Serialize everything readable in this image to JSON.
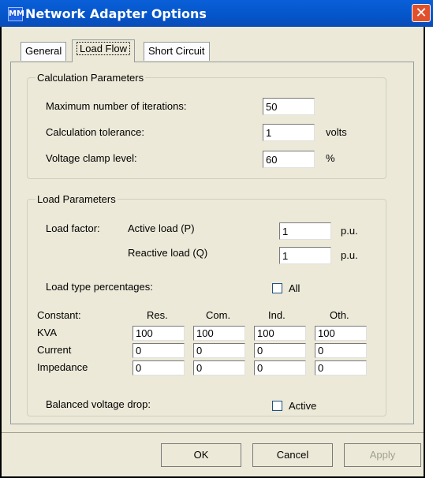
{
  "window": {
    "title": "Network Adapter Options",
    "icon": "MM",
    "close_glyph": "✕"
  },
  "tabs": [
    {
      "label": "General"
    },
    {
      "label": "Load Flow"
    },
    {
      "label": "Short Circuit"
    }
  ],
  "calculation": {
    "legend": "Calculation Parameters",
    "max_iterations": {
      "label": "Maximum number of iterations:",
      "value": "50"
    },
    "tolerance": {
      "label": "Calculation tolerance:",
      "value": "1",
      "unit": "volts"
    },
    "clamp": {
      "label": "Voltage clamp level:",
      "value": "60",
      "unit": "%"
    }
  },
  "load": {
    "legend": "Load Parameters",
    "load_factor_label": "Load factor:",
    "active": {
      "label": "Active load (P)",
      "value": "1",
      "unit": "p.u."
    },
    "reactive": {
      "label": "Reactive load (Q)",
      "value": "1",
      "unit": "p.u."
    },
    "type_percentages_label": "Load type percentages:",
    "all_label": "All",
    "constant_label": "Constant:",
    "columns": [
      "Res.",
      "Com.",
      "Ind.",
      "Oth."
    ],
    "rows": [
      {
        "label": "KVA",
        "values": [
          "100",
          "100",
          "100",
          "100"
        ]
      },
      {
        "label": "Current",
        "values": [
          "0",
          "0",
          "0",
          "0"
        ]
      },
      {
        "label": "Impedance",
        "values": [
          "0",
          "0",
          "0",
          "0"
        ]
      }
    ],
    "balanced_label": "Balanced voltage drop:",
    "active_label": "Active"
  },
  "buttons": {
    "ok": "OK",
    "cancel": "Cancel",
    "apply": "Apply"
  }
}
